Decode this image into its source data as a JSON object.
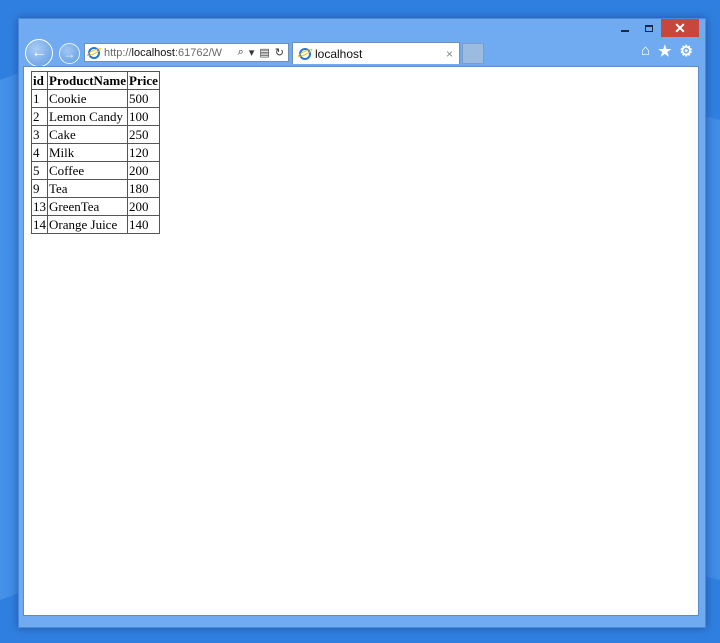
{
  "browser": {
    "address_url_prefix": "http://",
    "address_url_host": "localhost",
    "address_url_rest": ":61762/W",
    "tab_title": "localhost",
    "tab_close": "×",
    "back_glyph": "←",
    "forward_glyph": "→",
    "search_glyph": "⌕",
    "dropdown_glyph": "▾",
    "compat_glyph": "▤",
    "refresh_glyph": "↻",
    "home_glyph": "⌂",
    "favorites_glyph": "★",
    "tools_glyph": "⚙",
    "minimize_label": "",
    "close_glyph": "✕",
    "icons": {
      "back": "back-arrow-icon",
      "forward": "forward-arrow-icon",
      "page": "ie-logo-icon",
      "search": "search-icon",
      "refresh": "refresh-icon",
      "home": "home-icon",
      "favorites": "star-icon",
      "tools": "gear-icon"
    },
    "accent_close": "#c7473d",
    "frame_color": "#70aaf0"
  },
  "table": {
    "headers": [
      "id",
      "ProductName",
      "Price"
    ],
    "rows": [
      [
        "1",
        "Cookie",
        "500"
      ],
      [
        "2",
        "Lemon Candy",
        "100"
      ],
      [
        "3",
        "Cake",
        "250"
      ],
      [
        "4",
        "Milk",
        "120"
      ],
      [
        "5",
        "Coffee",
        "200"
      ],
      [
        "9",
        "Tea",
        "180"
      ],
      [
        "13",
        "GreenTea",
        "200"
      ],
      [
        "14",
        "Orange Juice",
        "140"
      ]
    ]
  }
}
